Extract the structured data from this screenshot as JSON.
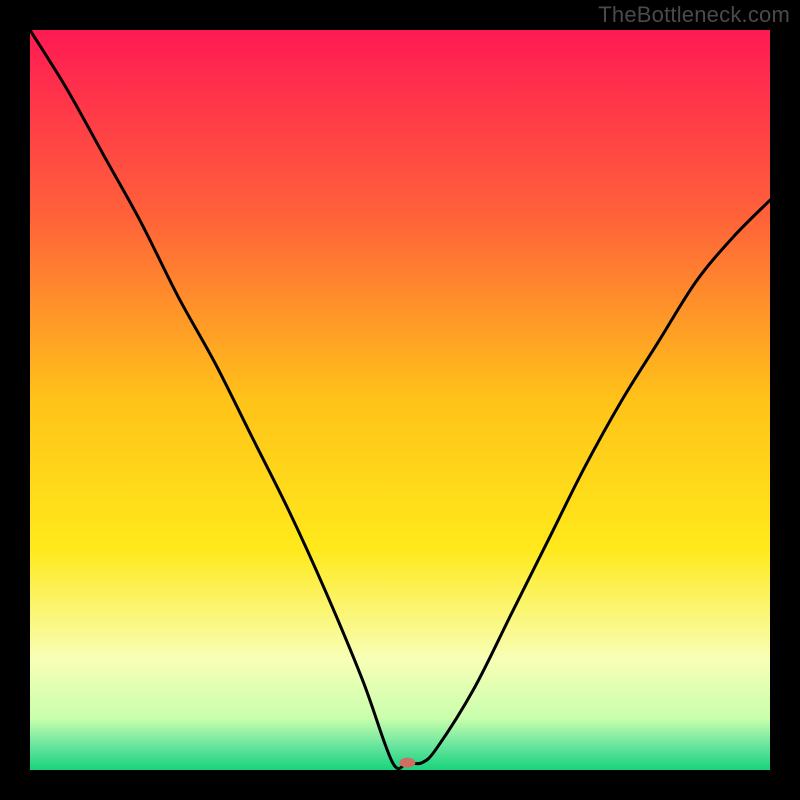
{
  "watermark": "TheBottleneck.com",
  "chart_data": {
    "type": "line",
    "title": "",
    "xlabel": "",
    "ylabel": "",
    "xlim": [
      0,
      100
    ],
    "ylim": [
      0,
      100
    ],
    "grid": false,
    "legend": false,
    "gradient_stops": [
      {
        "offset": 0,
        "color": "#ff1a53"
      },
      {
        "offset": 25,
        "color": "#ff613a"
      },
      {
        "offset": 50,
        "color": "#ffc319"
      },
      {
        "offset": 70,
        "color": "#ffe91b"
      },
      {
        "offset": 85,
        "color": "#f8ffb6"
      },
      {
        "offset": 93,
        "color": "#c9ffad"
      },
      {
        "offset": 97,
        "color": "#61e39c"
      },
      {
        "offset": 100,
        "color": "#18d37b"
      }
    ],
    "series": [
      {
        "name": "bottleneck-curve",
        "x": [
          0,
          5,
          10,
          15,
          20,
          25,
          30,
          35,
          40,
          45,
          49,
          51,
          53,
          55,
          60,
          65,
          70,
          75,
          80,
          85,
          90,
          95,
          100
        ],
        "y": [
          100,
          92,
          83,
          74,
          64,
          55,
          45,
          35,
          24,
          12,
          1,
          1,
          1,
          3,
          11,
          21,
          31,
          41,
          50,
          58,
          66,
          72,
          77
        ]
      }
    ],
    "marker": {
      "x": 51,
      "y": 1,
      "rx": 8,
      "ry": 5,
      "color": "#cf6e62"
    }
  }
}
